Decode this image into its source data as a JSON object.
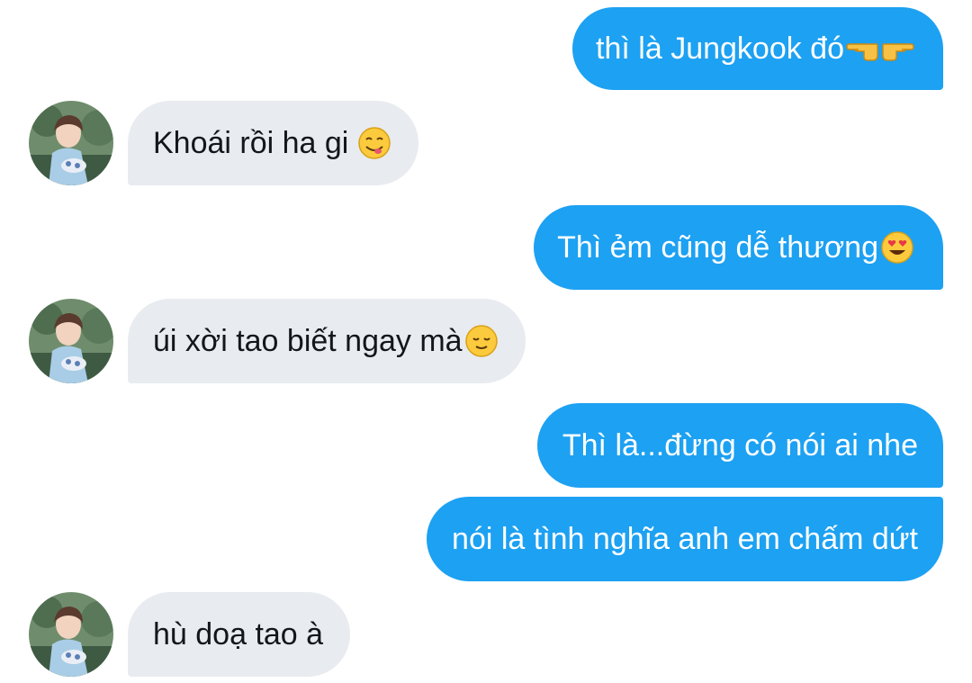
{
  "conversation": {
    "messages": [
      {
        "direction": "outgoing",
        "text": "thì là Jungkook đó",
        "emoji": [
          "backhand-index-left-icon",
          "backhand-index-right-icon"
        ]
      },
      {
        "direction": "incoming",
        "text": "Khoái rồi ha gi ",
        "emoji": [
          "face-savoring-food-icon"
        ]
      },
      {
        "direction": "outgoing",
        "text": "Thì ẻm cũng dễ thương",
        "emoji": [
          "heart-eyes-icon"
        ]
      },
      {
        "direction": "incoming",
        "text": "úi xời tao biết ngay mà",
        "emoji": [
          "relieved-face-icon"
        ]
      },
      {
        "direction": "outgoing",
        "text": "Thì là...đừng có nói ai nhe",
        "emoji": []
      },
      {
        "direction": "outgoing",
        "text": "nói là tình nghĩa anh em chấm dứt",
        "emoji": []
      },
      {
        "direction": "incoming",
        "text": "hù doạ tao à",
        "emoji": []
      }
    ]
  },
  "colors": {
    "outgoing_bubble": "#1da1f2",
    "incoming_bubble": "#e8ebef",
    "incoming_text": "#14171a",
    "background": "#ffffff"
  }
}
